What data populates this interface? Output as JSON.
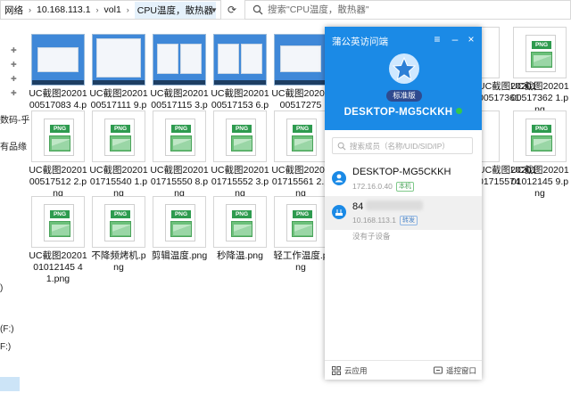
{
  "explorer": {
    "breadcrumb": [
      "网络",
      "10.168.113.1",
      "vol1",
      "CPU温度，散热器"
    ],
    "search_placeholder": "搜索\"CPU温度，散热器\"",
    "nav_labels": [
      "数码-乎",
      "有品缘",
      ")",
      "(F:)",
      "F:)"
    ],
    "files": [
      {
        "name": "UC截图2020100517083 4.png",
        "type": "shot"
      },
      {
        "name": "UC截图2020100517111 9.png",
        "type": "shot"
      },
      {
        "name": "UC截图2020100517115 3.png",
        "type": "shot"
      },
      {
        "name": "UC截图2020100517153 6.png",
        "type": "shot"
      },
      {
        "name": "UC截图2020100517275",
        "type": "shot"
      },
      {
        "name": "UC截图2020100517361",
        "type": "png"
      },
      {
        "name": "UC截图2020100517362 1.png",
        "type": "png"
      },
      {
        "name": "UC截图2020100517512 2.png",
        "type": "png"
      },
      {
        "name": "UC截图2020101715540 1.png",
        "type": "png"
      },
      {
        "name": "UC截图2020101715550 8.png",
        "type": "png"
      },
      {
        "name": "UC截图2020101715552 3.png",
        "type": "png"
      },
      {
        "name": "UC截图2020101715561 2.png",
        "type": "png"
      },
      {
        "name": "UC截图2020101715574",
        "type": "png"
      },
      {
        "name": "UC截图2020101012145 9.png",
        "type": "png"
      },
      {
        "name": "UC截图2020101012145 4 1.png",
        "type": "png"
      },
      {
        "name": "不降频烤机.png",
        "type": "png"
      },
      {
        "name": "剪辑温度.png",
        "type": "png"
      },
      {
        "name": "秒降温.png",
        "type": "png"
      },
      {
        "name": "轻工作温度.png",
        "type": "png"
      }
    ],
    "png_tag": "PNG"
  },
  "app": {
    "title": "蒲公英访问端",
    "edition_badge": "标准版",
    "device_title": "DESKTOP-MG5CKKH",
    "member_search_placeholder": "搜索成员（名称/UID/SID/IP）",
    "devices": [
      {
        "name": "DESKTOP-MG5CKKH",
        "ip": "172.16.0.40",
        "tag": "本机"
      },
      {
        "name": "84",
        "ip": "10.168.113.1",
        "tag": "转发"
      }
    ],
    "no_sub_devices": "没有子设备",
    "footer": {
      "cloud_apps": "云应用",
      "remote_window": "遥控窗口"
    },
    "colors": {
      "header": "#1b8ae6",
      "online": "#35c84b"
    }
  }
}
